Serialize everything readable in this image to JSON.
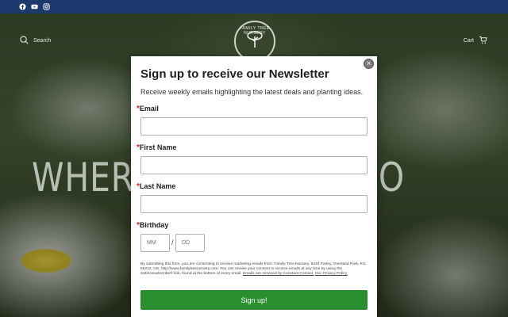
{
  "topbar": {
    "icons": [
      "facebook-icon",
      "youtube-icon",
      "instagram-icon"
    ],
    "bg": "#1d3a6e"
  },
  "header": {
    "search_label": "Search",
    "cart_label": "Cart",
    "logo_text": "FAMILY TREE NURSERY"
  },
  "hero": {
    "heading": "WHERE EVERYONE COMES TO"
  },
  "modal": {
    "title": "Sign up to receive our Newsletter",
    "subtitle": "Receive weekly emails highlighting the latest deals and planting ideas.",
    "close_label": "×",
    "required_mark": "*",
    "fields": {
      "email_label": "Email",
      "first_name_label": "First Name",
      "last_name_label": "Last Name",
      "birthday_label": "Birthday",
      "month_placeholder": "MM",
      "day_placeholder": "DD",
      "separator": "/"
    },
    "consent_text": "By submitting this form, you are consenting to receive marketing emails from: Family Tree Nursery, 8424 Farley, Overland Park, KS, 66212, US, http://www.familytreenursery.com. You can revoke your consent to receive emails at any time by using the SafeUnsubscribe® link, found at the bottom of every email.",
    "consent_link_1": "Emails are serviced by Constant Contact.",
    "consent_link_2": "Our Privacy Policy.",
    "submit_label": "Sign up!",
    "submit_color": "#2a8e2f",
    "required_color": "#d0242c"
  }
}
